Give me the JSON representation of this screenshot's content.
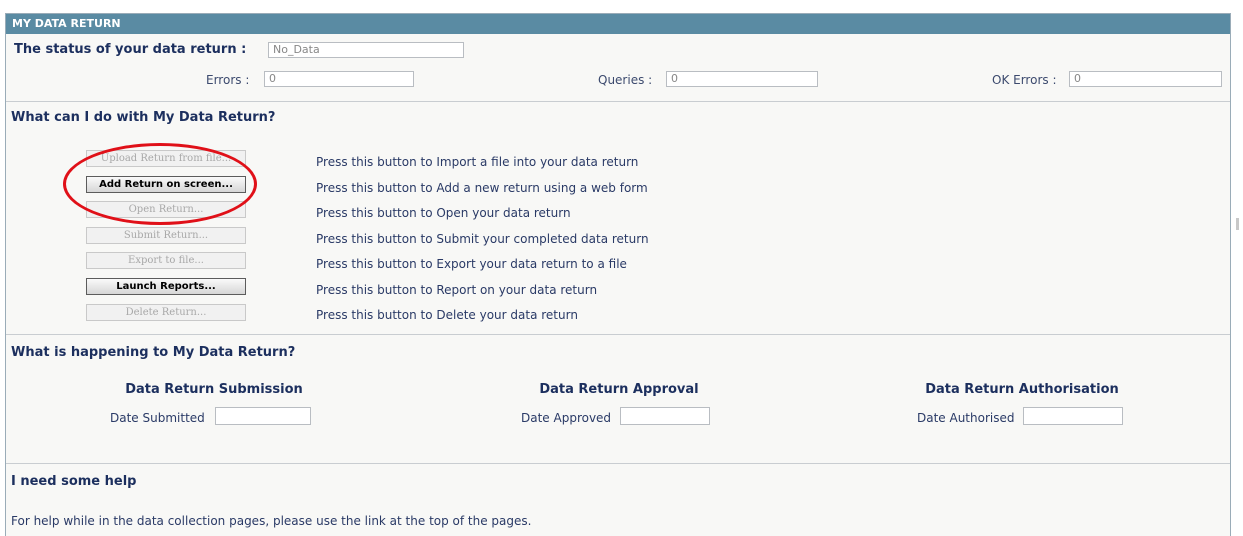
{
  "panel": {
    "title": "MY DATA RETURN"
  },
  "status": {
    "label": "The status of your data return :",
    "value": "No_Data",
    "errors_label": "Errors :",
    "errors_value": "0",
    "queries_label": "Queries :",
    "queries_value": "0",
    "ok_errors_label": "OK Errors :",
    "ok_errors_value": "0"
  },
  "actions": {
    "heading": "What can I do with My Data Return?",
    "items": [
      {
        "button": "Upload Return from file...",
        "description": "Press this button to Import a file into your data return"
      },
      {
        "button": "Add Return on screen...",
        "description": "Press this button to Add a new return using a web form"
      },
      {
        "button": "Open Return...",
        "description": "Press this button to Open your data return"
      },
      {
        "button": "Submit Return...",
        "description": "Press this button to Submit your completed data return"
      },
      {
        "button": "Export to file...",
        "description": "Press this button to Export your data return to a file"
      },
      {
        "button": "Launch Reports...",
        "description": "Press this button to Report on your data return"
      },
      {
        "button": "Delete Return...",
        "description": "Press this button to Delete your data return"
      }
    ]
  },
  "progress": {
    "heading": "What is happening to My Data Return?",
    "submission_heading": "Data Return Submission",
    "submitted_label": "Date Submitted",
    "submitted_value": "",
    "approval_heading": "Data Return Approval",
    "approved_label": "Date Approved",
    "approved_value": "",
    "authorisation_heading": "Data Return Authorisation",
    "authorised_label": "Date Authorised",
    "authorised_value": ""
  },
  "help": {
    "heading": "I need some help",
    "text": "For help while in the data collection pages, please use the link at the top of the pages."
  },
  "colors": {
    "titlebar": "#5a8ba3",
    "highlight": "#e01018"
  }
}
